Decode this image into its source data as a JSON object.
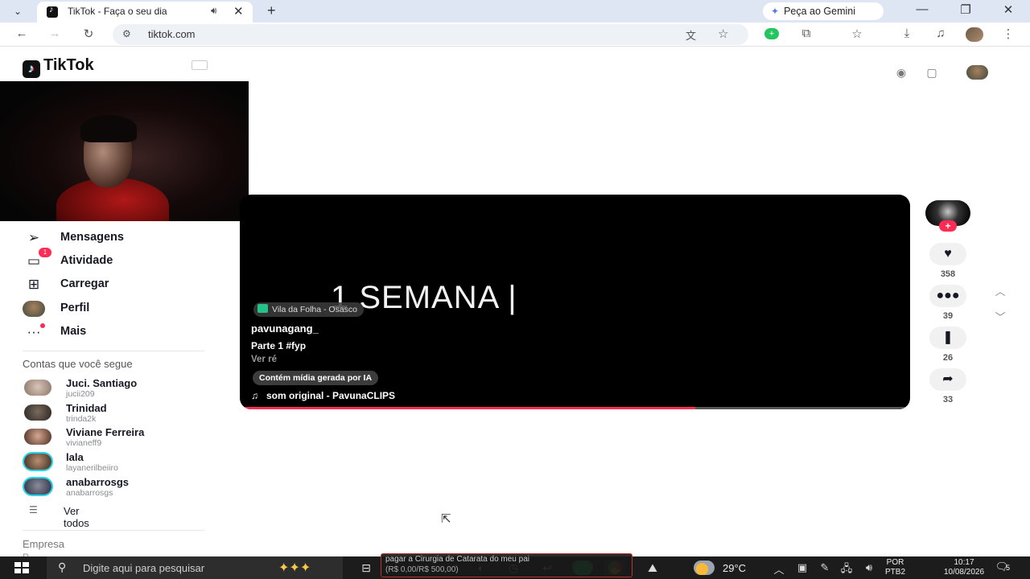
{
  "browser": {
    "tab_title": "TikTok - Faça o seu dia",
    "new_tab_label": "+",
    "gemini_label": "Peça ao Gemini",
    "url": "tiktok.com"
  },
  "tiktok": {
    "logo_text": "TikTok",
    "nav": [
      {
        "label": "Mensagens",
        "icon": "send-icon"
      },
      {
        "label": "Atividade",
        "icon": "inbox-icon",
        "badge": "1"
      },
      {
        "label": "Carregar",
        "icon": "upload-icon"
      },
      {
        "label": "Perfil",
        "icon": "avatar"
      },
      {
        "label": "Mais",
        "icon": "more-icon"
      }
    ],
    "following_heading": "Contas que você segue",
    "accounts": [
      {
        "name": "Juci. Santiago",
        "handle": "jucii209"
      },
      {
        "name": "Trinidad",
        "handle": "trinda2k"
      },
      {
        "name": "Viviane Ferreira",
        "handle": "vivianeff9"
      },
      {
        "name": "lala",
        "handle": "layanerilbeiiro"
      },
      {
        "name": "anabarrosgs",
        "handle": "anabarrosgs"
      }
    ],
    "see_all_label": "Ver todos",
    "company_label": "Empresa",
    "company_sub": "P"
  },
  "video": {
    "overlay_text": "1 SEMANA |",
    "location": "Vila da Folha - Osasco",
    "author": "pavunagang_",
    "caption": "Parte 1 #fyp",
    "see_more": "Ver ré",
    "ai_label": "Contém mídia gerada por IA",
    "sound": "som original - PavunaCLIPS",
    "progress": 0.68
  },
  "actions": {
    "follow_plus": "+",
    "likes": "358",
    "comments": "39",
    "saves": "26",
    "shares": "33"
  },
  "taskbar": {
    "search_placeholder": "Digite aqui para pesquisar",
    "notification_line1": "pagar a Cirurgia de Catarata do meu pai",
    "notification_line2": "(R$ 0,00/R$ 500,00)",
    "temperature": "29°C",
    "lang_line1": "POR",
    "lang_line2": "PTB2",
    "time": "10:17",
    "date": "10/08/2026",
    "notification_count": "5"
  }
}
